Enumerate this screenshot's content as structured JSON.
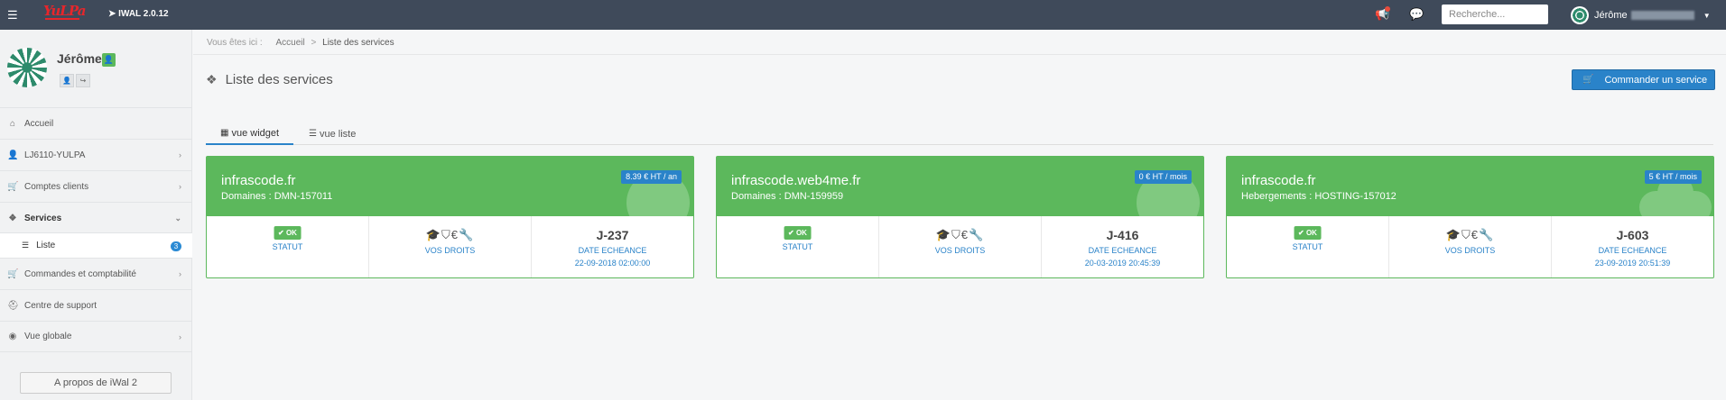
{
  "topbar": {
    "app_logo": "YuLPa",
    "version": "IWAL 2.0.12",
    "search_placeholder": "Recherche...",
    "user_name": "Jérôme"
  },
  "sidebar": {
    "profile_name": "Jérôme",
    "items": [
      {
        "label": "Accueil",
        "icon": "home-icon"
      },
      {
        "label": "LJ6110-YULPA",
        "icon": "user-icon"
      },
      {
        "label": "Comptes clients",
        "icon": "cart-icon"
      },
      {
        "label": "Services",
        "icon": "cubes-icon"
      },
      {
        "label": "Commandes et comptabilité",
        "icon": "cart-icon"
      },
      {
        "label": "Centre de support",
        "icon": "support-icon"
      },
      {
        "label": "Vue globale",
        "icon": "globe-icon"
      }
    ],
    "sub_item": {
      "label": "Liste",
      "count": "3"
    },
    "about_label": "A propos de iWal 2"
  },
  "breadcrumb": {
    "prefix": "Vous êtes ici :",
    "home": "Accueil",
    "sep": ">",
    "current": "Liste des services"
  },
  "page": {
    "title": "Liste des services",
    "order_button": "Commander un service"
  },
  "tabs": [
    {
      "label": "vue widget",
      "active": true
    },
    {
      "label": "vue liste",
      "active": false
    }
  ],
  "labels": {
    "status": "STATUT",
    "rights": "VOS DROITS",
    "due": "DATE ECHEANCE",
    "ok": "✔ OK"
  },
  "cards": [
    {
      "title": "infrascode.fr",
      "subtitle": "Domaines : DMN-157011",
      "price": "8.39 € HT / an",
      "art": "globe",
      "due": "J-237",
      "due_date": "22-09-2018 02:00:00"
    },
    {
      "title": "infrascode.web4me.fr",
      "subtitle": "Domaines : DMN-159959",
      "price": "0 € HT / mois",
      "art": "globe",
      "due": "J-416",
      "due_date": "20-03-2019 20:45:39"
    },
    {
      "title": "infrascode.fr",
      "subtitle": "Hebergements : HOSTING-157012",
      "price": "5 € HT / mois",
      "art": "cloud",
      "due": "J-603",
      "due_date": "23-09-2019 20:51:39"
    }
  ],
  "colors": {
    "topbar": "#3f4a5a",
    "card_green": "#5cb85c",
    "primary_blue": "#2a83c9"
  }
}
